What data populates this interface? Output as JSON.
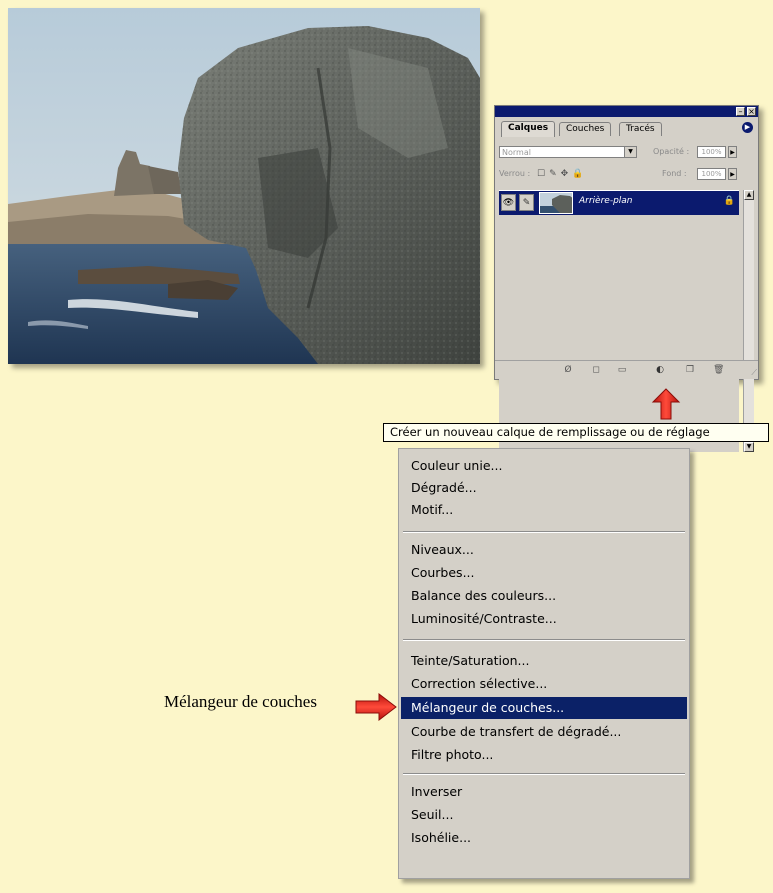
{
  "palette": {
    "tabs": [
      "Calques",
      "Couches",
      "Tracés"
    ],
    "blend_mode": "Normal",
    "opacity_label": "Opacité :",
    "opacity_value": "100%",
    "lock_label": "Verrou :",
    "fill_label": "Fond :",
    "fill_value": "100%",
    "layer_name": "Arrière-plan"
  },
  "tooltip": "Créer un nouveau calque de remplissage ou de réglage",
  "menu": {
    "groups": [
      [
        "Couleur unie...",
        "Dégradé...",
        "Motif..."
      ],
      [
        "Niveaux...",
        "Courbes...",
        "Balance des couleurs...",
        "Luminosité/Contraste..."
      ],
      [
        "Teinte/Saturation...",
        "Correction sélective...",
        "Mélangeur de couches...",
        "Courbe de transfert de dégradé...",
        "Filtre photo..."
      ],
      [
        "Inverser",
        "Seuil...",
        "Isohélie..."
      ]
    ],
    "highlighted": "Mélangeur de couches..."
  },
  "callout_label": "Mélangeur de couches",
  "colors": {
    "background": "#fcf6c9",
    "highlight": "#0b2167",
    "arrow_red": "#e8231c"
  }
}
